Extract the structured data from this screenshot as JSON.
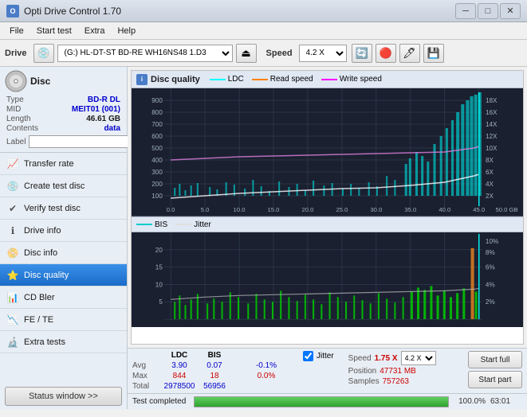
{
  "titleBar": {
    "appName": "Opti Drive Control 1.70",
    "minBtn": "─",
    "maxBtn": "□",
    "closeBtn": "✕"
  },
  "menuBar": {
    "items": [
      "File",
      "Start test",
      "Extra",
      "Help"
    ]
  },
  "driveToolbar": {
    "driveLabel": "Drive",
    "driveValue": "(G:) HL-DT-ST BD-RE  WH16NS48 1.D3",
    "speedLabel": "Speed",
    "speedValue": "4.2 X"
  },
  "discInfo": {
    "sectionTitle": "Disc",
    "typeLabel": "Type",
    "typeValue": "BD-R DL",
    "midLabel": "MID",
    "midValue": "MEIT01 (001)",
    "lengthLabel": "Length",
    "lengthValue": "46.61 GB",
    "contentsLabel": "Contents",
    "contentsValue": "data",
    "labelLabel": "Label",
    "labelValue": ""
  },
  "navItems": [
    {
      "id": "transfer-rate",
      "label": "Transfer rate",
      "icon": "📈"
    },
    {
      "id": "create-test-disc",
      "label": "Create test disc",
      "icon": "💿"
    },
    {
      "id": "verify-test-disc",
      "label": "Verify test disc",
      "icon": "✔"
    },
    {
      "id": "drive-info",
      "label": "Drive info",
      "icon": "ℹ"
    },
    {
      "id": "disc-info",
      "label": "Disc info",
      "icon": "📀"
    },
    {
      "id": "disc-quality",
      "label": "Disc quality",
      "icon": "⭐",
      "active": true
    },
    {
      "id": "cd-bler",
      "label": "CD Bler",
      "icon": "📊"
    },
    {
      "id": "fe-te",
      "label": "FE / TE",
      "icon": "📉"
    },
    {
      "id": "extra-tests",
      "label": "Extra tests",
      "icon": "🔬"
    }
  ],
  "statusWindow": {
    "label": "Status window >>"
  },
  "chart": {
    "title": "Disc quality",
    "headerIcon": "i",
    "legend": {
      "ldc": "LDC",
      "readSpeed": "Read speed",
      "writeSpeed": "Write speed"
    },
    "bottomLegend": {
      "bis": "BIS",
      "jitter": "Jitter"
    },
    "topYAxis": [
      "900",
      "800",
      "700",
      "600",
      "500",
      "400",
      "300",
      "200",
      "100"
    ],
    "topYAxisRight": [
      "18X",
      "16X",
      "14X",
      "12X",
      "10X",
      "8X",
      "6X",
      "4X",
      "2X"
    ],
    "bottomYAxis": [
      "20",
      "15",
      "10",
      "5"
    ],
    "bottomYAxisRight": [
      "10%",
      "8%",
      "6%",
      "4%",
      "2%"
    ],
    "xAxis": [
      "0.0",
      "5.0",
      "10.0",
      "15.0",
      "20.0",
      "25.0",
      "30.0",
      "35.0",
      "40.0",
      "45.0",
      "50.0 GB"
    ]
  },
  "stats": {
    "headers": [
      "",
      "LDC",
      "BIS",
      "",
      "Jitter",
      "Speed"
    ],
    "avgLabel": "Avg",
    "avgLdc": "3.90",
    "avgBis": "0.07",
    "avgJitter": "-0.1%",
    "maxLabel": "Max",
    "maxLdc": "844",
    "maxBis": "18",
    "maxJitter": "0.0%",
    "totalLabel": "Total",
    "totalLdc": "2978500",
    "totalBis": "56956",
    "jitterChecked": true,
    "jitterLabel": "Jitter",
    "speedValue": "1.75 X",
    "speedSelectValue": "4.2 X",
    "positionLabel": "Position",
    "positionValue": "47731 MB",
    "samplesLabel": "Samples",
    "samplesValue": "757263",
    "startFull": "Start full",
    "startPart": "Start part"
  },
  "progressBar": {
    "statusText": "Test completed",
    "percent": "100.0%",
    "percentValue": 100,
    "time": "63:01"
  }
}
